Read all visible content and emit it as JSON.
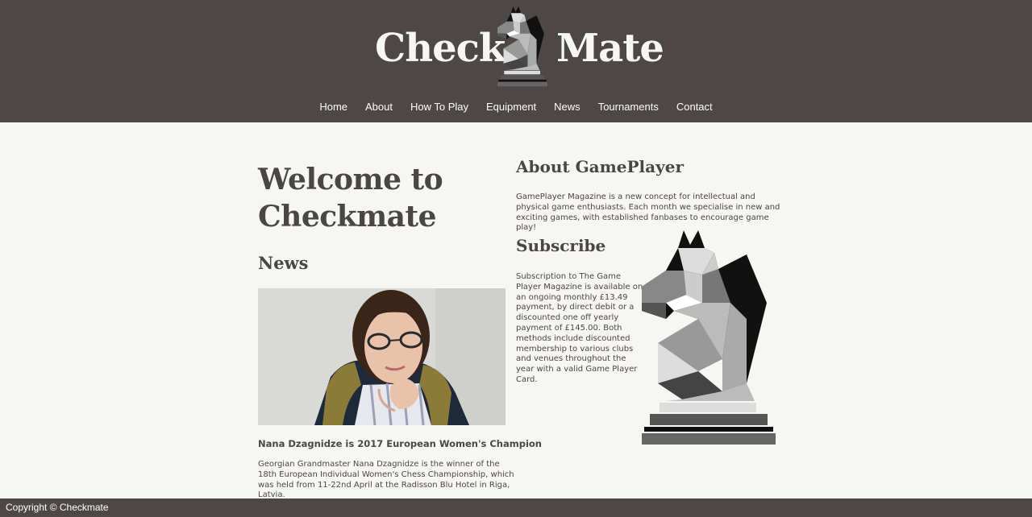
{
  "header": {
    "logo_left": "Check",
    "logo_right": "Mate",
    "nav": [
      "Home",
      "About",
      "How To Play",
      "Equipment",
      "News",
      "Tournaments",
      "Contact"
    ]
  },
  "main": {
    "welcome": "Welcome to Checkmate",
    "news_heading": "News",
    "news_item": {
      "title": "Nana Dzagnidze is 2017 European Women's Champion",
      "body": "Georgian Grandmaster Nana Dzagnidze is the winner of the 18th European Individual Women's Chess Championship, which was held from 11-22nd April at the Radisson Blu Hotel in Riga, Latvia."
    }
  },
  "sidebar": {
    "about_heading": "About GamePlayer",
    "about_body": "GamePlayer Magazine is a new concept for intellectual and physical game enthusiasts. Each month we specialise in new and exciting games, with established fanbases to encourage game play!",
    "subscribe_heading": "Subscribe",
    "subscribe_body": "Subscription to The Game Player Magazine is available on an ongoing monthly £13.49 payment, by direct debit or a discounted one off yearly payment of £145.00. Both methods include discounted membership to various clubs and venues throughout the year with a valid Game Player Card."
  },
  "footer": {
    "copyright": "Copyright © Checkmate"
  },
  "colors": {
    "header_bg": "#4d4747",
    "page_bg": "#f6f7f2",
    "text": "#4a4646"
  }
}
